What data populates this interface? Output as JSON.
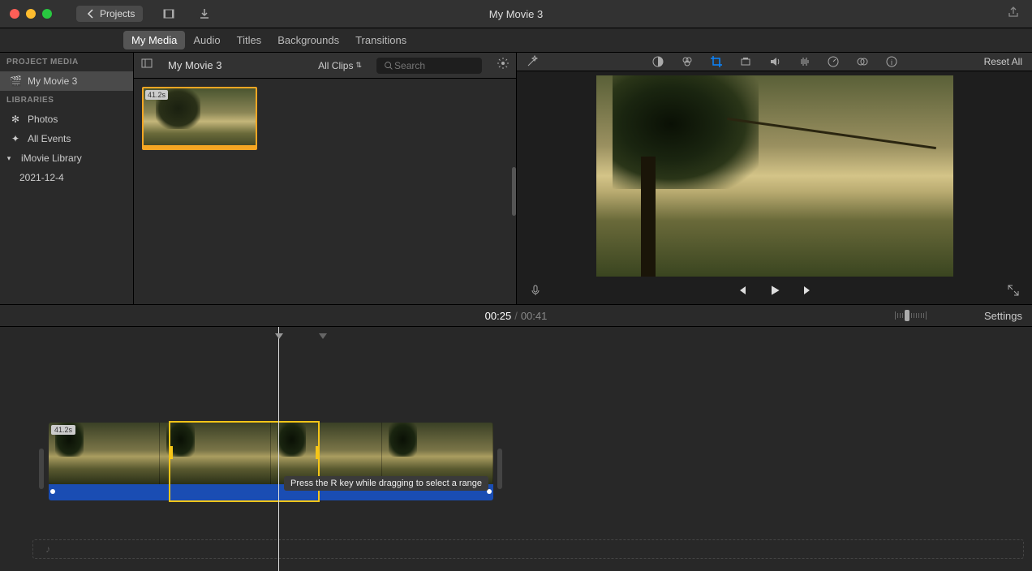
{
  "window": {
    "title": "My Movie 3"
  },
  "toolbar": {
    "back_label": "Projects"
  },
  "tabs": {
    "my_media": "My Media",
    "audio": "Audio",
    "titles": "Titles",
    "backgrounds": "Backgrounds",
    "transitions": "Transitions"
  },
  "sidebar": {
    "hdr_project_media": "PROJECT MEDIA",
    "project_name": "My Movie 3",
    "hdr_libraries": "LIBRARIES",
    "photos": "Photos",
    "all_events": "All Events",
    "imovie_lib": "iMovie Library",
    "event_date": "2021-12-4"
  },
  "browser": {
    "title": "My Movie 3",
    "filter": "All Clips",
    "search_placeholder": "Search",
    "clip_duration": "41.2s"
  },
  "preview": {
    "reset": "Reset All"
  },
  "timecode": {
    "current": "00:25",
    "total": "00:41",
    "settings": "Settings"
  },
  "timeline": {
    "clip_duration": "41.2s",
    "tooltip": "Press the R key while dragging to select a range"
  }
}
